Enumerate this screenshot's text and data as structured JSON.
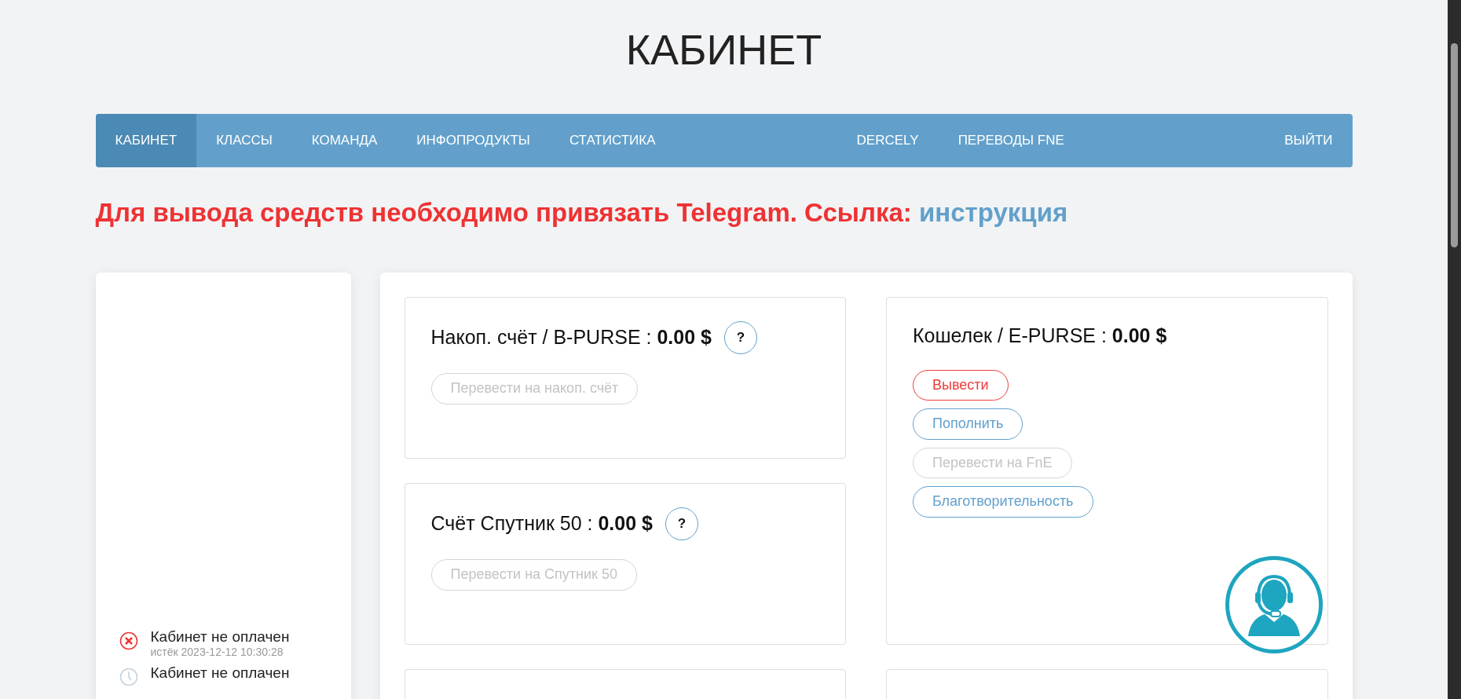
{
  "page_title": "КАБИНЕТ",
  "nav": {
    "left": [
      {
        "label": "КАБИНЕТ",
        "selected": true
      },
      {
        "label": "КЛАССЫ",
        "selected": false
      },
      {
        "label": "КОМАНДА",
        "selected": false
      },
      {
        "label": "ИНФОПРОДУКТЫ",
        "selected": false
      },
      {
        "label": "СТАТИСТИКА",
        "selected": false
      }
    ],
    "center": [
      {
        "label": "DERCELY",
        "selected": false
      },
      {
        "label": "ПЕРЕВОДЫ FNE",
        "selected": false
      }
    ],
    "right": [
      {
        "label": "ВЫЙТИ",
        "selected": false
      }
    ]
  },
  "alert": {
    "text": "Для вывода средств необходимо привязать Telegram. Ссылка:",
    "link": "инструкция"
  },
  "status_items": [
    {
      "kind": "error",
      "title": "Кабинет не оплачен",
      "subtitle": "истёк 2023-12-12 10:30:28"
    },
    {
      "kind": "pending",
      "title": "Кабинет не оплачен"
    }
  ],
  "accounts": [
    {
      "title": "Накоп. счёт / B-PURSE : **0.00 $**",
      "help": "?",
      "buttons": [
        {
          "label": "Перевести на накоп. счёт",
          "kind": "normal",
          "disabled": true
        }
      ]
    },
    {
      "title": "Кошелек / E-PURSE : **0.00 $**",
      "buttons": [
        {
          "label": "Вывести",
          "kind": "danger",
          "disabled": false
        },
        {
          "label": "Пополнить",
          "kind": "normal",
          "disabled": false
        },
        {
          "label": "Перевести на FnE",
          "kind": "normal",
          "disabled": true
        },
        {
          "label": "Благотворительность",
          "kind": "normal",
          "disabled": false
        }
      ]
    },
    {
      "title": "Счёт Спутник 50 : **0.00 $**",
      "help": "?",
      "buttons": [
        {
          "label": "Перевести на Спутник 50",
          "kind": "normal",
          "disabled": true
        }
      ]
    }
  ]
}
